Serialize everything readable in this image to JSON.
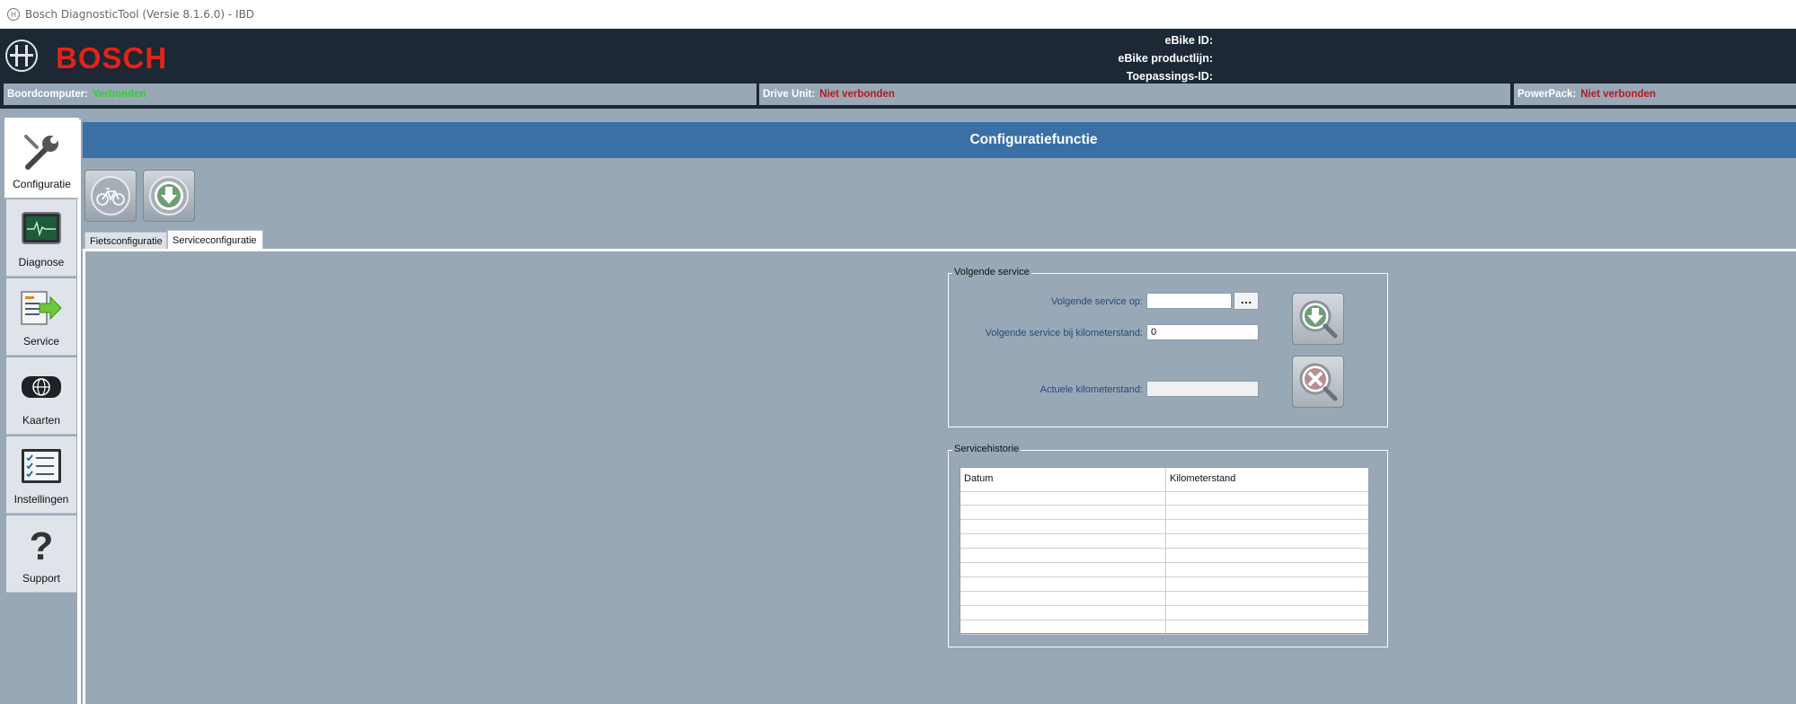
{
  "window": {
    "title": "Bosch DiagnosticTool (Versie 8.1.6.0) - IBD"
  },
  "header": {
    "logo": "BOSCH",
    "ebike_id_label": "eBike ID:",
    "productline_label": "eBike productlijn:",
    "application_id_label": "Toepassings-ID:"
  },
  "status": {
    "boardcomputer": {
      "label": "Boordcomputer:",
      "value": "Verbonden",
      "color": "#2fd12b"
    },
    "drive_unit": {
      "label": "Drive Unit:",
      "value": "Niet verbonden",
      "color": "#c0141b"
    },
    "powerpack": {
      "label": "PowerPack:",
      "value": "Niet verbonden",
      "color": "#c0141b"
    }
  },
  "sidebar": {
    "items": [
      {
        "label": "Configuratie",
        "icon": "wrench-icon",
        "active": true
      },
      {
        "label": "Diagnose",
        "icon": "monitor-pulse-icon",
        "active": false
      },
      {
        "label": "Service",
        "icon": "service-arrow-icon",
        "active": false
      },
      {
        "label": "Kaarten",
        "icon": "globe-icon",
        "active": false
      },
      {
        "label": "Instellingen",
        "icon": "checklist-icon",
        "active": false
      },
      {
        "label": "Support",
        "icon": "question-icon",
        "active": false
      }
    ]
  },
  "main": {
    "title": "Configuratiefunctie",
    "toolbar": [
      {
        "icon": "bicycle-icon"
      },
      {
        "icon": "download-icon"
      }
    ],
    "tabs": [
      {
        "label": "Fietsconfiguratie",
        "active": false
      },
      {
        "label": "Serviceconfiguratie",
        "active": true
      }
    ],
    "next_service": {
      "group_title": "Volgende service",
      "date_label": "Volgende service op:",
      "date_value": "",
      "date_picker_label": "...",
      "km_label": "Volgende service bij kilometerstand:",
      "km_value": "0",
      "current_km_label": "Actuele kilometerstand:",
      "current_km_value": ""
    },
    "history": {
      "group_title": "Servicehistorie",
      "columns": [
        "Datum",
        "Kilometerstand"
      ],
      "rows": []
    }
  }
}
